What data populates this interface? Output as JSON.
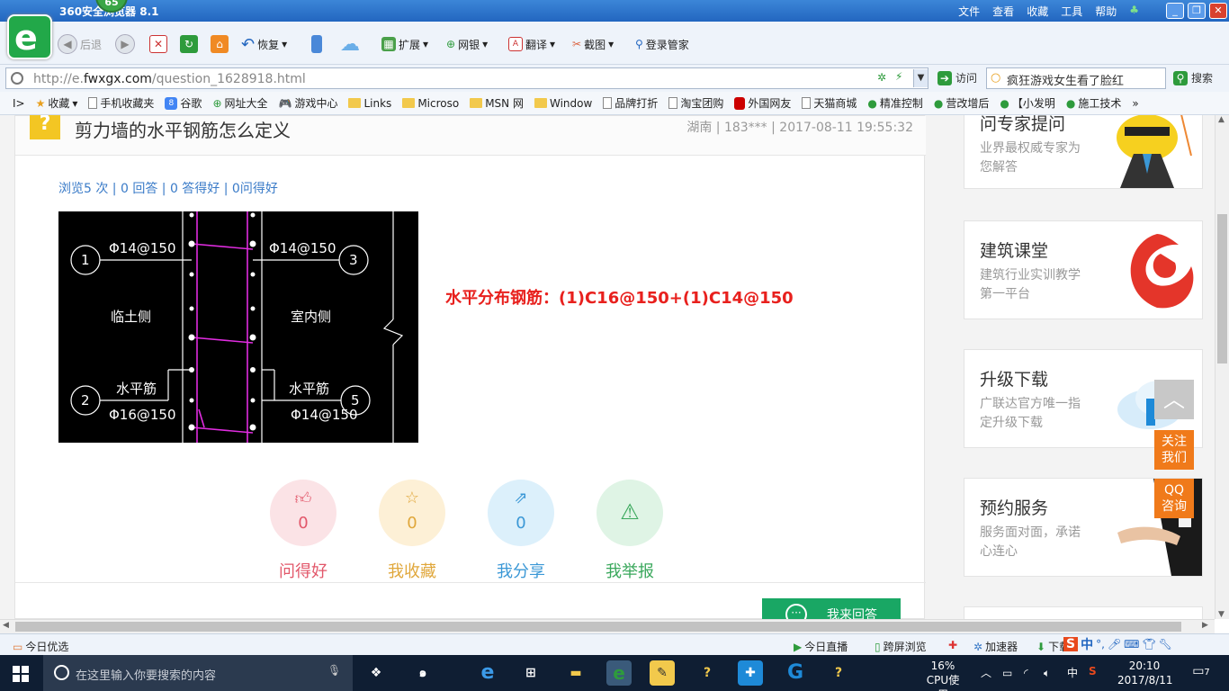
{
  "browser": {
    "title": "360安全浏览器 8.1",
    "badge": "65",
    "menu": [
      "文件",
      "查看",
      "收藏",
      "工具",
      "帮助"
    ],
    "nav": {
      "back": "后退",
      "restore": "恢复",
      "ext": "扩展",
      "bank": "网银",
      "translate": "翻译",
      "screenshot": "截图",
      "login": "登录管家"
    },
    "url_prefix": "http://e.",
    "url_domain": "fwxgx.com",
    "url_path": "/question_1628918.html",
    "visit": "访问",
    "search_text": "疯狂游戏女生看了脸红",
    "search_btn": "搜索"
  },
  "favorites": [
    "收藏",
    "手机收藏夹",
    "谷歌",
    "网址大全",
    "游戏中心",
    "Links",
    "Microso",
    "MSN 网",
    "Window",
    "品牌打折",
    "淘宝团购",
    "外国网友",
    "天猫商城",
    "精准控制",
    "营改增后",
    "【小发明",
    "施工技术"
  ],
  "question": {
    "title": "剪力墙的水平钢筋怎么定义",
    "meta": "湖南 | 183*** | 2017-08-11 19:55:32",
    "stats": "浏览5 次 | 0 回答 | 0 答得好 | 0问得好",
    "formula": "水平分布钢筋：(1)C16@150+(1)C14@150",
    "cad": {
      "labels": [
        "1",
        "2",
        "3",
        "5"
      ],
      "rebar_top_left": "Φ14@150",
      "rebar_top_right": "Φ14@150",
      "left_side": "临土侧",
      "right_side": "室内侧",
      "horiz_left": "水平筋",
      "horiz_right": "水平筋",
      "rebar_bottom_left": "Φ16@150",
      "rebar_bottom_right": "Φ14@150"
    }
  },
  "actions": [
    {
      "label": "问得好",
      "count": "0",
      "icon": "thumbs-up-icon",
      "bg": "#fbe3e6",
      "fg": "#e2576a"
    },
    {
      "label": "我收藏",
      "count": "0",
      "icon": "star-icon",
      "bg": "#fdf0d6",
      "fg": "#e0a73b"
    },
    {
      "label": "我分享",
      "count": "0",
      "icon": "share-icon",
      "bg": "#dcf0fb",
      "fg": "#3b98d6"
    },
    {
      "label": "我举报",
      "count": "",
      "icon": "warning-icon",
      "bg": "#dff4e5",
      "fg": "#3aa85c"
    }
  ],
  "answer_btn": "我来回答",
  "sidebar": [
    {
      "title": "问专家提问",
      "sub": "业界最权威专家为您解答"
    },
    {
      "title": "建筑课堂",
      "sub": "建筑行业实训教学第一平台"
    },
    {
      "title": "升级下载",
      "sub": "广联达官方唯一指定升级下载"
    },
    {
      "title": "预约服务",
      "sub": "服务面对面，承诺心连心"
    }
  ],
  "float_buttons": {
    "follow": "关注我们",
    "qq": "QQ咨询"
  },
  "statusbar": {
    "left": "今日优选",
    "live": "今日直播",
    "cast": "跨屏浏览",
    "accel": "加速器",
    "download": "下载"
  },
  "taskbar": {
    "search_placeholder": "在这里输入你要搜索的内容",
    "cpu_pct": "16%",
    "cpu_label": "CPU使用",
    "ime": "中",
    "time": "20:10",
    "date": "2017/8/11",
    "notif": "7"
  }
}
